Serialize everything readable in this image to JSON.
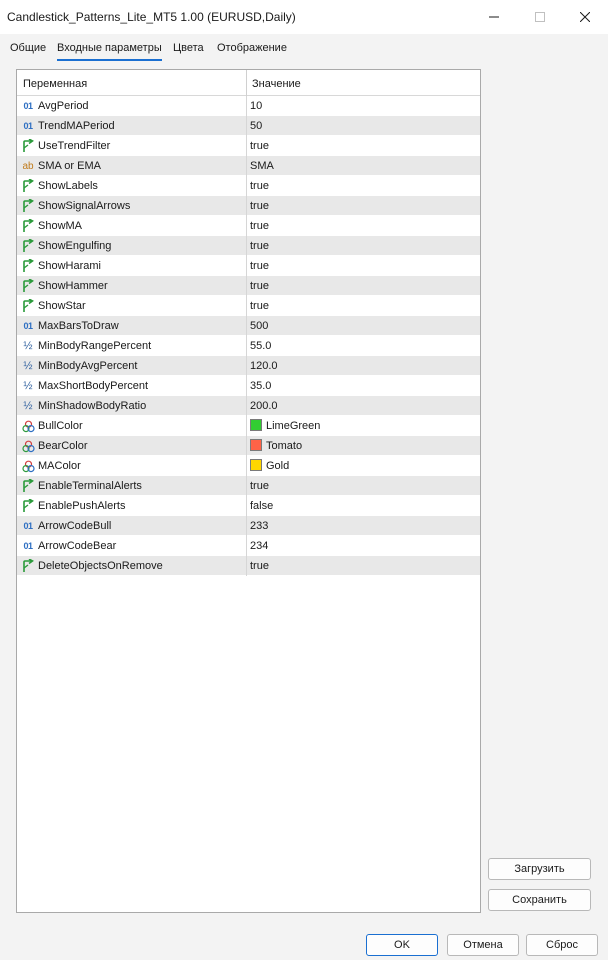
{
  "window": {
    "title": "Candlestick_Patterns_Lite_MT5 1.00 (EURUSD,Daily)"
  },
  "tabs": [
    {
      "label": "Общие"
    },
    {
      "label": "Входные параметры",
      "active": true
    },
    {
      "label": "Цвета"
    },
    {
      "label": "Отображение"
    }
  ],
  "grid": {
    "col_variable": "Переменная",
    "col_value": "Значение",
    "rows": [
      {
        "name": "AvgPeriod",
        "value": "10",
        "type": "int"
      },
      {
        "name": "TrendMAPeriod",
        "value": "50",
        "type": "int"
      },
      {
        "name": "UseTrendFilter",
        "value": "true",
        "type": "bool"
      },
      {
        "name": "SMA or EMA",
        "value": "SMA",
        "type": "string"
      },
      {
        "name": "ShowLabels",
        "value": "true",
        "type": "bool"
      },
      {
        "name": "ShowSignalArrows",
        "value": "true",
        "type": "bool"
      },
      {
        "name": "ShowMA",
        "value": "true",
        "type": "bool"
      },
      {
        "name": "ShowEngulfing",
        "value": "true",
        "type": "bool"
      },
      {
        "name": "ShowHarami",
        "value": "true",
        "type": "bool"
      },
      {
        "name": "ShowHammer",
        "value": "true",
        "type": "bool"
      },
      {
        "name": "ShowStar",
        "value": "true",
        "type": "bool"
      },
      {
        "name": "MaxBarsToDraw",
        "value": "500",
        "type": "int"
      },
      {
        "name": "MinBodyRangePercent",
        "value": "55.0",
        "type": "double"
      },
      {
        "name": "MinBodyAvgPercent",
        "value": "120.0",
        "type": "double"
      },
      {
        "name": "MaxShortBodyPercent",
        "value": "35.0",
        "type": "double"
      },
      {
        "name": "MinShadowBodyRatio",
        "value": "200.0",
        "type": "double"
      },
      {
        "name": "BullColor",
        "value": "LimeGreen",
        "type": "color",
        "color": "#32cd32"
      },
      {
        "name": "BearColor",
        "value": "Tomato",
        "type": "color",
        "color": "#ff6347"
      },
      {
        "name": "MAColor",
        "value": "Gold",
        "type": "color",
        "color": "#ffd700"
      },
      {
        "name": "EnableTerminalAlerts",
        "value": "true",
        "type": "bool"
      },
      {
        "name": "EnablePushAlerts",
        "value": "false",
        "type": "bool"
      },
      {
        "name": "ArrowCodeBull",
        "value": "233",
        "type": "int"
      },
      {
        "name": "ArrowCodeBear",
        "value": "234",
        "type": "int"
      },
      {
        "name": "DeleteObjectsOnRemove",
        "value": "true",
        "type": "bool"
      }
    ]
  },
  "side_buttons": {
    "load_label": "Загрузить",
    "save_label": "Сохранить"
  },
  "footer": {
    "ok_label": "OK",
    "cancel_label": "Отмена",
    "reset_label": "Сброс"
  },
  "icons": {
    "int": "int-type-icon",
    "bool": "bool-type-icon",
    "string": "string-type-icon",
    "double": "double-type-icon",
    "color": "color-type-icon"
  },
  "colors": {
    "accent": "#1a6fd1",
    "row_alt": "#e8e8e8"
  }
}
